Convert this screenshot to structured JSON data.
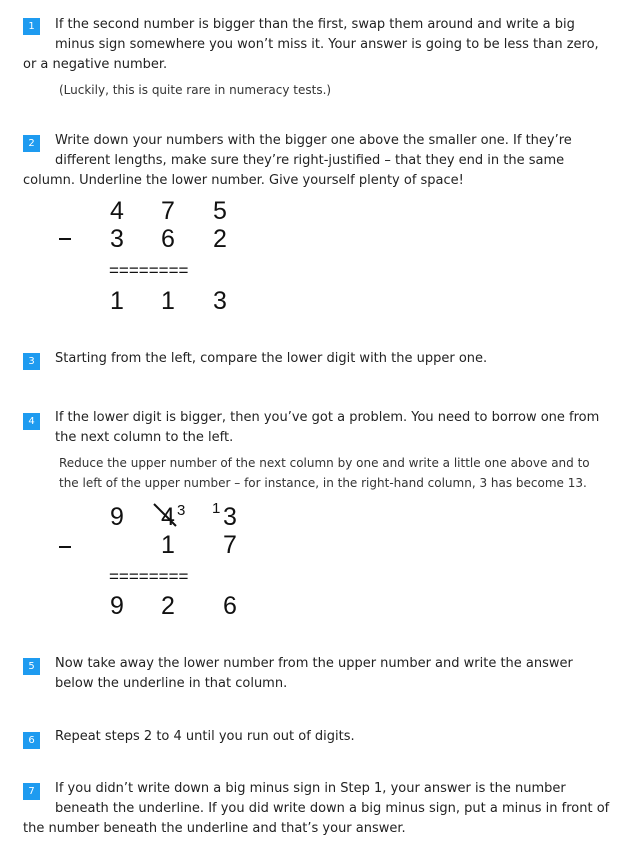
{
  "steps": [
    {
      "number": "1",
      "lines": [
        "If the second number is bigger than the first, swap them around and write a big",
        "minus sign somewhere you won’t miss it. Your answer is going to be less than zero,",
        "or a negative number."
      ],
      "note": [
        "(Luckily, this is quite rare in numeracy tests.)"
      ]
    },
    {
      "number": "2",
      "lines": [
        "Write down your numbers with the bigger one above the smaller one. If they’re",
        "different lengths, make sure they’re right-justified – that they end in the same",
        "column. Underline the lower number. Give yourself plenty of space!"
      ]
    },
    {
      "number": "3",
      "lines": [
        "Starting from the left, compare the lower digit with the upper one."
      ]
    },
    {
      "number": "4",
      "lines": [
        "If the lower digit is bigger, then you’ve got a problem. You need to borrow one from",
        "the next column to the left."
      ],
      "note": [
        "Reduce the upper number of the next column by one and write a little one above and to",
        "the left of the upper number – for instance, in the right-hand column, 3 has become 13."
      ]
    },
    {
      "number": "5",
      "lines": [
        "Now take away the lower number from the upper number and write the answer",
        "below the underline in that column."
      ]
    },
    {
      "number": "6",
      "lines": [
        "Repeat steps 2 to 4 until you run out of digits."
      ]
    },
    {
      "number": "7",
      "lines": [
        "If you didn’t write down a big minus sign in Step 1, your answer is the number",
        "beneath the underline. If you did write down a big minus sign, put a minus in front of",
        "the number beneath the underline and that’s your answer."
      ]
    }
  ],
  "example1": {
    "top": [
      "4",
      "7",
      "5"
    ],
    "bottom": [
      "3",
      "6",
      "2"
    ],
    "underline": "========",
    "result": [
      "1",
      "1",
      "3"
    ]
  },
  "example2": {
    "top": [
      "9",
      "4",
      "3"
    ],
    "borrow_tens": "3",
    "borrow_ones": "1",
    "bottom": [
      "1",
      "7"
    ],
    "underline": "========",
    "result": [
      "9",
      "2",
      "6"
    ]
  }
}
